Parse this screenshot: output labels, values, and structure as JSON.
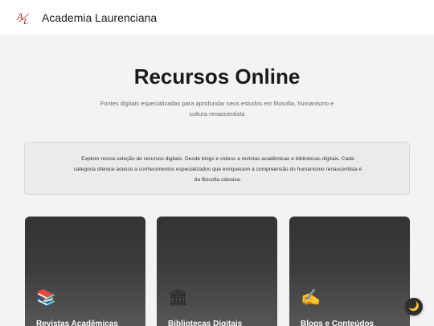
{
  "header": {
    "logo_icon": "academia-monogram-icon",
    "brand": "Academia Laurenciana"
  },
  "hero": {
    "title": "Recursos Online",
    "subtitle": "Fontes digitais especializadas para aprofundar seus estudos em filosofia, humanismo e cultura renascentista"
  },
  "intro": {
    "text": "Explore nossa seleção de recursos digitais. Desde blogs e vídeos a revistas acadêmicas e bibliotecas digitais. Cada categoria oferece acesso a conhecimentos especializados que enriquecem a compreensão do humanismo renascentista e da filosofia clássica."
  },
  "cards": [
    {
      "icon": "📚",
      "icon_name": "books-icon",
      "title": "Revistas Acadêmicas"
    },
    {
      "icon": "🏛",
      "icon_name": "classical-building-icon",
      "title": "Bibliotecas Digitais"
    },
    {
      "icon": "✍",
      "icon_name": "writing-hand-icon",
      "title": "Blogs e Conteúdos"
    }
  ],
  "theme_toggle": {
    "icon": "🌙",
    "icon_name": "moon-icon"
  },
  "colors": {
    "logo_accent": "#b0262c",
    "card_dark": "#333333",
    "page_bg": "#f3f3f3"
  }
}
